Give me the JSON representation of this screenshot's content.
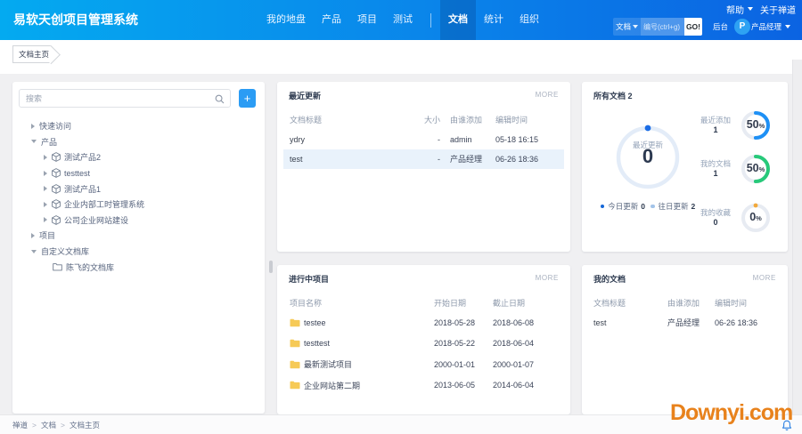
{
  "header": {
    "brand": "易软天创项目管理系统",
    "nav": [
      {
        "label": "我的地盘",
        "active": false
      },
      {
        "label": "产品",
        "active": false
      },
      {
        "label": "项目",
        "active": false
      },
      {
        "label": "测试",
        "active": false,
        "divider_after": true
      },
      {
        "label": "文档",
        "active": true
      },
      {
        "label": "统计",
        "active": false
      },
      {
        "label": "组织",
        "active": false
      }
    ],
    "help_label": "帮助",
    "about_label": "关于禅道",
    "search": {
      "scope": "文档",
      "placeholder": "编号(ctrl+g)",
      "go_label": "GO!"
    },
    "admin_label": "后台",
    "user": {
      "initial": "P",
      "name": "产品经理"
    }
  },
  "page_tab": "文档主页",
  "sidebar": {
    "search_placeholder": "搜索",
    "add_label": "+",
    "tree": [
      {
        "label": "快速访问",
        "level": 0,
        "caret": "collapsed",
        "icon": "none"
      },
      {
        "label": "产品",
        "level": 0,
        "caret": "expanded",
        "icon": "none"
      },
      {
        "label": "测试产品2",
        "level": 1,
        "caret": "collapsed",
        "icon": "product"
      },
      {
        "label": "testtest",
        "level": 1,
        "caret": "collapsed",
        "icon": "product"
      },
      {
        "label": "测试产品1",
        "level": 1,
        "caret": "collapsed",
        "icon": "product"
      },
      {
        "label": "企业内部工时管理系统",
        "level": 1,
        "caret": "collapsed",
        "icon": "product"
      },
      {
        "label": "公司企业网站建设",
        "level": 1,
        "caret": "collapsed",
        "icon": "product"
      },
      {
        "label": "项目",
        "level": 0,
        "caret": "collapsed",
        "icon": "none"
      },
      {
        "label": "自定义文档库",
        "level": 0,
        "caret": "expanded",
        "icon": "none"
      },
      {
        "label": "陈飞的文档库",
        "level": 1,
        "caret": "none",
        "icon": "folder-outline"
      }
    ]
  },
  "recent_card": {
    "title": "最近更新",
    "more_label": "MORE",
    "columns": [
      "文档标题",
      "大小",
      "由谁添加",
      "编辑时间"
    ],
    "rows": [
      {
        "title": "ydry",
        "size": "-",
        "added_by": "admin",
        "edited": "05-18 16:15",
        "highlight": false
      },
      {
        "title": "test",
        "size": "-",
        "added_by": "产品经理",
        "edited": "06-26 18:36",
        "highlight": true
      }
    ]
  },
  "all_docs_card": {
    "title": "所有文档",
    "count": "2",
    "chart_data": {
      "type": "donut",
      "big": {
        "label": "最近更新",
        "value": "0",
        "percent": 0
      },
      "legend": [
        {
          "label": "今日更新",
          "value": "0",
          "color": "#1567d8"
        },
        {
          "label": "往日更新",
          "value": "2",
          "color": "#a3c4e9"
        }
      ],
      "minis": [
        {
          "label": "最近添加",
          "value": "1",
          "percent": 50,
          "color": "#1e90f5"
        },
        {
          "label": "我的文档",
          "value": "1",
          "percent": 50,
          "color": "#27c97a"
        },
        {
          "label": "我的收藏",
          "value": "0",
          "percent": 0,
          "color": "#f2a93b"
        }
      ]
    }
  },
  "projects_card": {
    "title": "进行中项目",
    "more_label": "MORE",
    "columns": [
      "项目名称",
      "开始日期",
      "截止日期"
    ],
    "rows": [
      {
        "name": "testee",
        "start": "2018-05-28",
        "end": "2018-06-08"
      },
      {
        "name": "testtest",
        "start": "2018-05-22",
        "end": "2018-06-04"
      },
      {
        "name": "最新测试项目",
        "start": "2000-01-01",
        "end": "2000-01-07"
      },
      {
        "name": "企业网站第二期",
        "start": "2013-06-05",
        "end": "2014-06-04"
      }
    ]
  },
  "my_docs_card": {
    "title": "我的文档",
    "more_label": "MORE",
    "columns": [
      "文档标题",
      "由谁添加",
      "编辑时间"
    ],
    "rows": [
      {
        "title": "test",
        "added_by": "产品经理",
        "edited": "06-26 18:36"
      }
    ]
  },
  "footer": {
    "breadcrumb": [
      "禅道",
      "文档",
      "文档主页"
    ]
  },
  "watermark": "Downyi.com",
  "colors": {
    "header_gradient_start": "#04aaf0",
    "header_gradient_end": "#0b63e2",
    "accent_blue": "#2196f3",
    "green": "#27c97a",
    "orange": "#f2a93b",
    "folder_yellow": "#f6ca57",
    "highlight_row": "#e9f2fb",
    "watermark_orange": "#e8821c",
    "big_donut_track": "#e3ecf8",
    "big_donut_dot": "#1b6ce5"
  }
}
